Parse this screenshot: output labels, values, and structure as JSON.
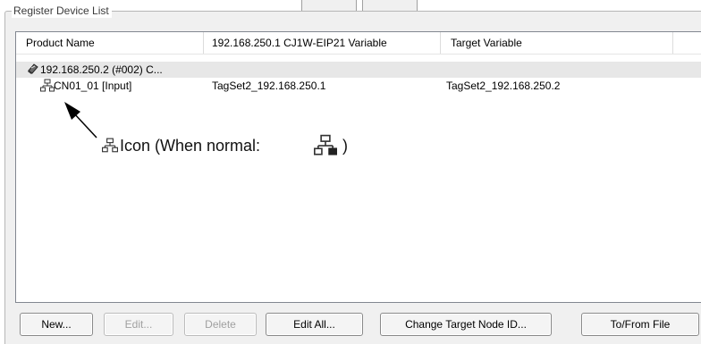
{
  "group": {
    "title": "Register Device List"
  },
  "columns": [
    {
      "label": "Product Name"
    },
    {
      "label": "192.168.250.1 CJ1W-EIP21 Variable"
    },
    {
      "label": "Target Variable"
    }
  ],
  "rows": [
    {
      "product": "192.168.250.2 (#002) C...",
      "variable": "",
      "target": "",
      "icon": "device-icon",
      "selected": true
    },
    {
      "product": "CN01_01 [Input]",
      "variable": "TagSet2_192.168.250.1",
      "target": "TagSet2_192.168.250.2",
      "icon": "network-error-icon",
      "selected": false
    }
  ],
  "annotation": {
    "icon_label": "Icon (When normal:",
    "close_paren": ")"
  },
  "buttons": {
    "new": "New...",
    "edit": "Edit...",
    "delete": "Delete",
    "edit_all": "Edit All...",
    "change_target": "Change Target Node ID...",
    "to_from_file": "To/From File"
  },
  "colors": {
    "selected_row": "#e7e7e7",
    "window_bg": "#f0f0f0",
    "disabled_text": "#a0a0a0"
  }
}
